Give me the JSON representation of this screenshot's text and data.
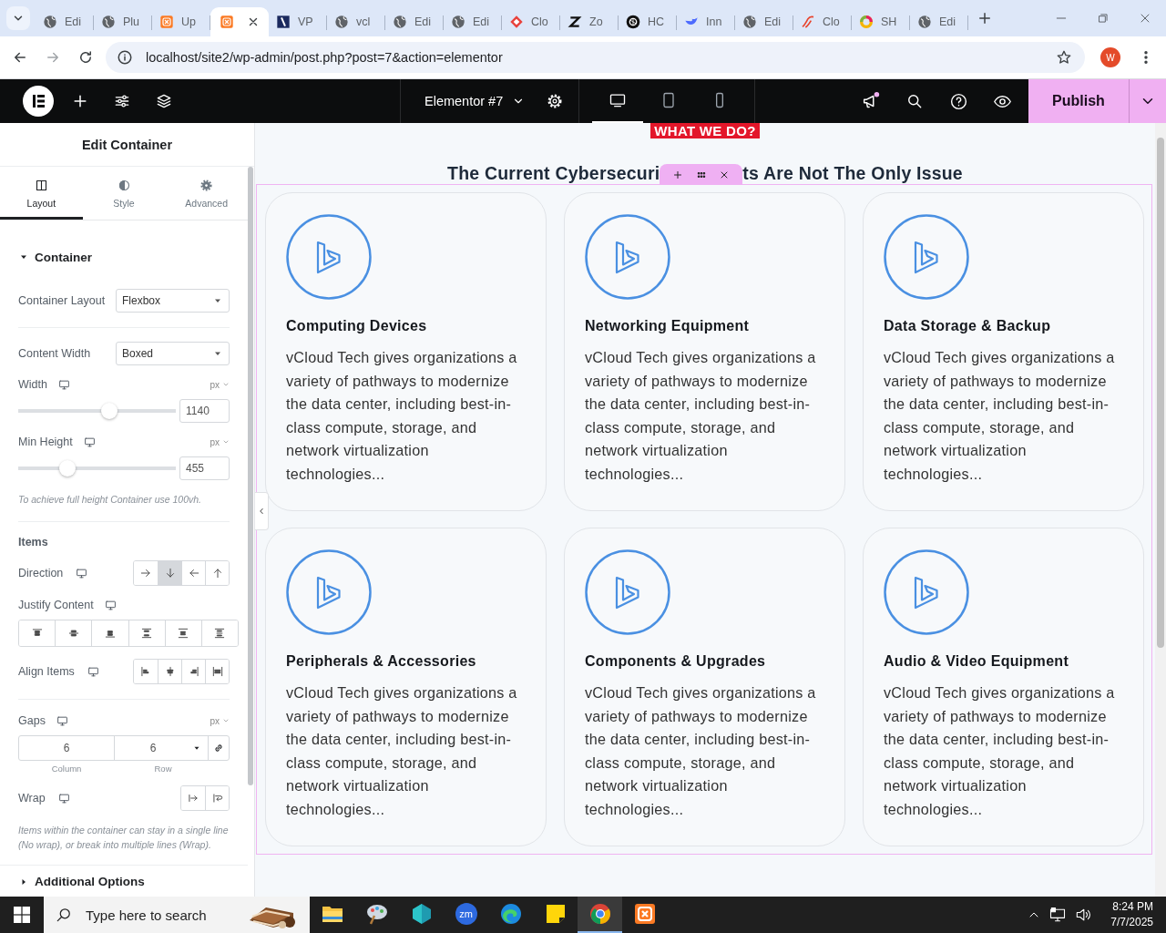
{
  "browser": {
    "tabs": [
      {
        "kind": "globe",
        "label": "Edi",
        "selected": false
      },
      {
        "kind": "globe",
        "label": "Plu",
        "selected": false
      },
      {
        "kind": "xampp",
        "label": "Up",
        "selected": false
      },
      {
        "kind": "xampp",
        "selected": true
      },
      {
        "kind": "slash",
        "label": "VP",
        "selected": false
      },
      {
        "kind": "globe",
        "label": "vcl",
        "selected": false
      },
      {
        "kind": "globe",
        "label": "Edi",
        "selected": false
      },
      {
        "kind": "globe",
        "label": "Edi",
        "selected": false
      },
      {
        "kind": "diamond",
        "label": "Clo",
        "selected": false
      },
      {
        "kind": "zigzag",
        "label": "Zo",
        "selected": false
      },
      {
        "kind": "knot",
        "label": "HC",
        "selected": false
      },
      {
        "kind": "bird",
        "label": "Inn",
        "selected": false
      },
      {
        "kind": "globe",
        "label": "Edi",
        "selected": false
      },
      {
        "kind": "swoosh",
        "label": "Clo",
        "selected": false
      },
      {
        "kind": "ring",
        "label": "SH",
        "selected": false
      },
      {
        "kind": "globe",
        "label": "Edi",
        "selected": false
      }
    ],
    "url": "localhost/site2/wp-admin/post.php?post=7&action=elementor",
    "profile": "W"
  },
  "topbar": {
    "document": "Elementor #7",
    "devices": [
      {
        "kind": "desktop",
        "selected": true
      },
      {
        "kind": "tablet",
        "selected": false
      },
      {
        "kind": "mobile",
        "selected": false
      }
    ],
    "notification": true,
    "publish": "Publish"
  },
  "panel": {
    "title": "Edit Container",
    "tabs": [
      {
        "kind": "columns",
        "label": "Layout",
        "selected": true
      },
      {
        "kind": "contrast",
        "label": "Style",
        "selected": false
      },
      {
        "kind": "gear",
        "label": "Advanced",
        "selected": false
      }
    ],
    "section": {
      "label": "Container",
      "expanded": true
    },
    "groups": [
      [
        {
          "kind": "select",
          "label": "Container Layout",
          "value": "Flexbox"
        }
      ],
      [
        {
          "kind": "select",
          "label": "Content Width",
          "value": "Boxed"
        },
        {
          "kind": "slider",
          "label": "Width",
          "device_icon": true,
          "unit": "px",
          "level": 0.58,
          "value": "1140"
        },
        {
          "kind": "slider",
          "label": "Min Height",
          "device_icon": true,
          "unit": "px",
          "level": 0.31,
          "value": "455"
        },
        {
          "kind": "note",
          "text": "To achieve full height Container use 100vh."
        }
      ],
      [
        {
          "kind": "heading",
          "text": "Items"
        },
        {
          "kind": "choices",
          "label": "Direction",
          "device_icon": true,
          "options": [
            {
              "kind": "arrow-right",
              "selected": false
            },
            {
              "kind": "arrow-down",
              "selected": true
            },
            {
              "kind": "arrow-left",
              "selected": false
            },
            {
              "kind": "arrow-up",
              "selected": false
            }
          ]
        },
        {
          "kind": "choices-wide",
          "label": "Justify Content",
          "device_icon": true,
          "options": [
            {
              "kind": "j-start",
              "selected": false
            },
            {
              "kind": "j-center",
              "selected": false
            },
            {
              "kind": "j-end",
              "selected": false
            },
            {
              "kind": "j-between",
              "selected": false
            },
            {
              "kind": "j-around",
              "selected": false
            },
            {
              "kind": "j-evenly",
              "selected": false
            }
          ]
        },
        {
          "kind": "choices",
          "label": "Align Items",
          "device_icon": true,
          "options": [
            {
              "kind": "a-start",
              "selected": false
            },
            {
              "kind": "a-center",
              "selected": false
            },
            {
              "kind": "a-end",
              "selected": false
            },
            {
              "kind": "a-stretch",
              "selected": false
            }
          ]
        }
      ],
      [
        {
          "kind": "gaps",
          "label": "Gaps",
          "device_icon": true,
          "unit": "px",
          "column": "6",
          "row": "6",
          "column_label": "Column",
          "row_label": "Row"
        },
        {
          "kind": "choices",
          "label": "Wrap",
          "device_icon": true,
          "options": [
            {
              "kind": "nowrap",
              "selected": false
            },
            {
              "kind": "wrap",
              "selected": false
            }
          ]
        },
        {
          "kind": "note",
          "text": "Items within the container can stay in a single line (No wrap), or break into multiple lines (Wrap)."
        }
      ]
    ],
    "footer_section": {
      "label": "Additional Options",
      "expanded": false
    }
  },
  "canvas": {
    "badge": "WHAT WE DO?",
    "heading_parts": [
      "The Current Cybersecuri",
      "ts Are Not The Only Issue"
    ],
    "cards": [
      {
        "title": "Computing Devices",
        "text": "vCloud Tech gives organizations a variety of pathways to modernize the data center, including best-in-class compute, storage, and network virtualization technologies..."
      },
      {
        "title": "Networking Equipment",
        "text": "vCloud Tech gives organizations a variety of pathways to modernize the data center, including best-in-class compute, storage, and network virtualization technologies..."
      },
      {
        "title": "Data Storage & Backup",
        "text": "vCloud Tech gives organizations a variety of pathways to modernize the data center, including best-in-class compute, storage, and network virtualization technologies..."
      },
      {
        "title": "Peripherals & Accessories",
        "text": "vCloud Tech gives organizations a variety of pathways to modernize the data center, including best-in-class compute, storage, and network virtualization technologies..."
      },
      {
        "title": "Components & Upgrades",
        "text": "vCloud Tech gives organizations a variety of pathways to modernize the data center, including best-in-class compute, storage, and network virtualization technologies..."
      },
      {
        "title": "Audio & Video Equipment",
        "text": "vCloud Tech gives organizations a variety of pathways to modernize the data center, including best-in-class compute, storage, and network virtualization technologies..."
      }
    ]
  },
  "taskbar": {
    "search_placeholder": "Type here to search",
    "apps": [
      {
        "kind": "folder",
        "selected": false
      },
      {
        "kind": "palette",
        "selected": false
      },
      {
        "kind": "gem",
        "selected": false
      },
      {
        "kind": "zoom",
        "label": "zm",
        "selected": false
      },
      {
        "kind": "edge",
        "selected": false
      },
      {
        "kind": "note",
        "selected": false
      },
      {
        "kind": "chrome",
        "selected": true
      },
      {
        "kind": "xampp",
        "selected": false
      }
    ],
    "time": "8:24 PM",
    "date": "7/7/2025"
  }
}
